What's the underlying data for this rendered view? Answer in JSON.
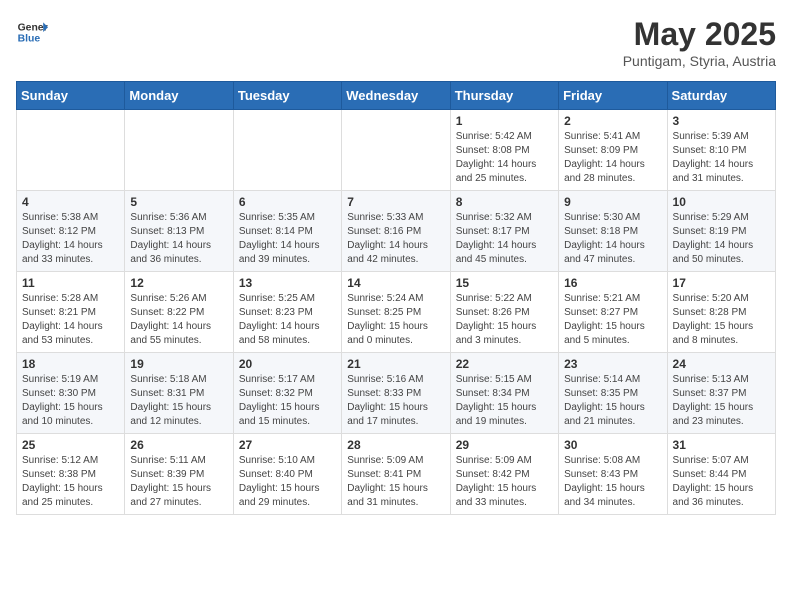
{
  "header": {
    "logo_general": "General",
    "logo_blue": "Blue",
    "title": "May 2025",
    "subtitle": "Puntigam, Styria, Austria"
  },
  "weekdays": [
    "Sunday",
    "Monday",
    "Tuesday",
    "Wednesday",
    "Thursday",
    "Friday",
    "Saturday"
  ],
  "weeks": [
    [
      {
        "day": "",
        "sunrise": "",
        "sunset": "",
        "daylight": ""
      },
      {
        "day": "",
        "sunrise": "",
        "sunset": "",
        "daylight": ""
      },
      {
        "day": "",
        "sunrise": "",
        "sunset": "",
        "daylight": ""
      },
      {
        "day": "",
        "sunrise": "",
        "sunset": "",
        "daylight": ""
      },
      {
        "day": "1",
        "sunrise": "Sunrise: 5:42 AM",
        "sunset": "Sunset: 8:08 PM",
        "daylight": "Daylight: 14 hours and 25 minutes."
      },
      {
        "day": "2",
        "sunrise": "Sunrise: 5:41 AM",
        "sunset": "Sunset: 8:09 PM",
        "daylight": "Daylight: 14 hours and 28 minutes."
      },
      {
        "day": "3",
        "sunrise": "Sunrise: 5:39 AM",
        "sunset": "Sunset: 8:10 PM",
        "daylight": "Daylight: 14 hours and 31 minutes."
      }
    ],
    [
      {
        "day": "4",
        "sunrise": "Sunrise: 5:38 AM",
        "sunset": "Sunset: 8:12 PM",
        "daylight": "Daylight: 14 hours and 33 minutes."
      },
      {
        "day": "5",
        "sunrise": "Sunrise: 5:36 AM",
        "sunset": "Sunset: 8:13 PM",
        "daylight": "Daylight: 14 hours and 36 minutes."
      },
      {
        "day": "6",
        "sunrise": "Sunrise: 5:35 AM",
        "sunset": "Sunset: 8:14 PM",
        "daylight": "Daylight: 14 hours and 39 minutes."
      },
      {
        "day": "7",
        "sunrise": "Sunrise: 5:33 AM",
        "sunset": "Sunset: 8:16 PM",
        "daylight": "Daylight: 14 hours and 42 minutes."
      },
      {
        "day": "8",
        "sunrise": "Sunrise: 5:32 AM",
        "sunset": "Sunset: 8:17 PM",
        "daylight": "Daylight: 14 hours and 45 minutes."
      },
      {
        "day": "9",
        "sunrise": "Sunrise: 5:30 AM",
        "sunset": "Sunset: 8:18 PM",
        "daylight": "Daylight: 14 hours and 47 minutes."
      },
      {
        "day": "10",
        "sunrise": "Sunrise: 5:29 AM",
        "sunset": "Sunset: 8:19 PM",
        "daylight": "Daylight: 14 hours and 50 minutes."
      }
    ],
    [
      {
        "day": "11",
        "sunrise": "Sunrise: 5:28 AM",
        "sunset": "Sunset: 8:21 PM",
        "daylight": "Daylight: 14 hours and 53 minutes."
      },
      {
        "day": "12",
        "sunrise": "Sunrise: 5:26 AM",
        "sunset": "Sunset: 8:22 PM",
        "daylight": "Daylight: 14 hours and 55 minutes."
      },
      {
        "day": "13",
        "sunrise": "Sunrise: 5:25 AM",
        "sunset": "Sunset: 8:23 PM",
        "daylight": "Daylight: 14 hours and 58 minutes."
      },
      {
        "day": "14",
        "sunrise": "Sunrise: 5:24 AM",
        "sunset": "Sunset: 8:25 PM",
        "daylight": "Daylight: 15 hours and 0 minutes."
      },
      {
        "day": "15",
        "sunrise": "Sunrise: 5:22 AM",
        "sunset": "Sunset: 8:26 PM",
        "daylight": "Daylight: 15 hours and 3 minutes."
      },
      {
        "day": "16",
        "sunrise": "Sunrise: 5:21 AM",
        "sunset": "Sunset: 8:27 PM",
        "daylight": "Daylight: 15 hours and 5 minutes."
      },
      {
        "day": "17",
        "sunrise": "Sunrise: 5:20 AM",
        "sunset": "Sunset: 8:28 PM",
        "daylight": "Daylight: 15 hours and 8 minutes."
      }
    ],
    [
      {
        "day": "18",
        "sunrise": "Sunrise: 5:19 AM",
        "sunset": "Sunset: 8:30 PM",
        "daylight": "Daylight: 15 hours and 10 minutes."
      },
      {
        "day": "19",
        "sunrise": "Sunrise: 5:18 AM",
        "sunset": "Sunset: 8:31 PM",
        "daylight": "Daylight: 15 hours and 12 minutes."
      },
      {
        "day": "20",
        "sunrise": "Sunrise: 5:17 AM",
        "sunset": "Sunset: 8:32 PM",
        "daylight": "Daylight: 15 hours and 15 minutes."
      },
      {
        "day": "21",
        "sunrise": "Sunrise: 5:16 AM",
        "sunset": "Sunset: 8:33 PM",
        "daylight": "Daylight: 15 hours and 17 minutes."
      },
      {
        "day": "22",
        "sunrise": "Sunrise: 5:15 AM",
        "sunset": "Sunset: 8:34 PM",
        "daylight": "Daylight: 15 hours and 19 minutes."
      },
      {
        "day": "23",
        "sunrise": "Sunrise: 5:14 AM",
        "sunset": "Sunset: 8:35 PM",
        "daylight": "Daylight: 15 hours and 21 minutes."
      },
      {
        "day": "24",
        "sunrise": "Sunrise: 5:13 AM",
        "sunset": "Sunset: 8:37 PM",
        "daylight": "Daylight: 15 hours and 23 minutes."
      }
    ],
    [
      {
        "day": "25",
        "sunrise": "Sunrise: 5:12 AM",
        "sunset": "Sunset: 8:38 PM",
        "daylight": "Daylight: 15 hours and 25 minutes."
      },
      {
        "day": "26",
        "sunrise": "Sunrise: 5:11 AM",
        "sunset": "Sunset: 8:39 PM",
        "daylight": "Daylight: 15 hours and 27 minutes."
      },
      {
        "day": "27",
        "sunrise": "Sunrise: 5:10 AM",
        "sunset": "Sunset: 8:40 PM",
        "daylight": "Daylight: 15 hours and 29 minutes."
      },
      {
        "day": "28",
        "sunrise": "Sunrise: 5:09 AM",
        "sunset": "Sunset: 8:41 PM",
        "daylight": "Daylight: 15 hours and 31 minutes."
      },
      {
        "day": "29",
        "sunrise": "Sunrise: 5:09 AM",
        "sunset": "Sunset: 8:42 PM",
        "daylight": "Daylight: 15 hours and 33 minutes."
      },
      {
        "day": "30",
        "sunrise": "Sunrise: 5:08 AM",
        "sunset": "Sunset: 8:43 PM",
        "daylight": "Daylight: 15 hours and 34 minutes."
      },
      {
        "day": "31",
        "sunrise": "Sunrise: 5:07 AM",
        "sunset": "Sunset: 8:44 PM",
        "daylight": "Daylight: 15 hours and 36 minutes."
      }
    ]
  ]
}
